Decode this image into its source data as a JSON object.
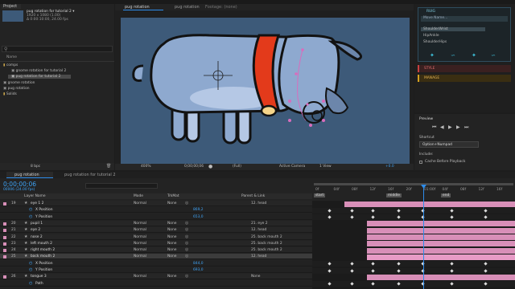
{
  "project": {
    "tab_label": "Project",
    "comp_name": "pug rotation for tutorial 2 ▾",
    "comp_info1": "1920 x 1080 (1.00)",
    "comp_info2": "Δ 0:00:10:00, 24.00 fps",
    "name_header": "Name",
    "items": [
      "comps",
      "gnome rotation for tutorial 2",
      "pug rotation for tutorial 2",
      "gnome rotation",
      "pug rotation",
      "Solids"
    ],
    "bpc": "8 bpc"
  },
  "viewer": {
    "tab_label": "pug rotation",
    "tab2_label": "pug rotation",
    "tab3_label": "Footage: (none)",
    "zoom": "400%",
    "timecode": "0;00;00;06",
    "resolution": "(Full)",
    "camera": "Active Camera",
    "views": "1 View",
    "exposure": "+0.0"
  },
  "effect_panel": {
    "title": "RUIG",
    "search_placeholder": "Move Name...",
    "items": [
      "ShoulderWrist",
      "HipAnkle",
      "ShoulderHips"
    ],
    "style_label": "STYLE",
    "manage_label": "MANAGE"
  },
  "preview": {
    "title": "Preview",
    "shortcut_label": "Shortcut",
    "shortcut_value": "Option+Numpad",
    "include_label": "Include:",
    "cache_label": "Cache Before Playback"
  },
  "timeline": {
    "tab1": "pug rotation",
    "tab2": "pug rotation for tutorial 2",
    "timecode": "0;00;00;06",
    "fps": "00006 (24.00 fps)",
    "headers": {
      "layer_name": "Layer Name",
      "mode": "Mode",
      "trkmat": "TrkMat",
      "parent": "Parent & Link"
    },
    "ruler": [
      "0f",
      "04f",
      "08f",
      "12f",
      "16f",
      "20f",
      "01:00f",
      "04f",
      "08f",
      "12f",
      "16f"
    ],
    "markers": [
      "start",
      "middle",
      "end"
    ],
    "rows": [
      {
        "num": "19",
        "name": "eye 1 2",
        "mode": "Normal",
        "trk": "None",
        "parent": "12. head"
      },
      {
        "num": "",
        "name": "X Position",
        "value": "869,2"
      },
      {
        "num": "",
        "name": "Y Position",
        "value": "653,0"
      },
      {
        "num": "20",
        "name": "pupil 1",
        "mode": "Normal",
        "trk": "None",
        "parent": "21. eye 2"
      },
      {
        "num": "21",
        "name": "eye 2",
        "mode": "Normal",
        "trk": "None",
        "parent": "12. head"
      },
      {
        "num": "22",
        "name": "nose 2",
        "mode": "Normal",
        "trk": "None",
        "parent": "25. back mouth 2"
      },
      {
        "num": "23",
        "name": "left mouth 2",
        "mode": "Normal",
        "trk": "None",
        "parent": "25. back mouth 2"
      },
      {
        "num": "24",
        "name": "right mouth 2",
        "mode": "Normal",
        "trk": "None",
        "parent": "25. back mouth 2"
      },
      {
        "num": "25",
        "name": "back mouth 2",
        "mode": "Normal",
        "trk": "None",
        "parent": "12. head"
      },
      {
        "num": "",
        "name": "X Position",
        "value": "844,0"
      },
      {
        "num": "",
        "name": "Y Position",
        "value": "693,0"
      },
      {
        "num": "26",
        "name": "tongue 3",
        "mode": "Normal",
        "trk": "None",
        "parent": "None"
      },
      {
        "num": "",
        "name": "Path",
        "value": ""
      }
    ]
  },
  "colors": {
    "accent": "#2d8ceb",
    "pink": "#d88fb8",
    "comp_bg": "#3d5a79",
    "collar": "#e33a1b"
  }
}
